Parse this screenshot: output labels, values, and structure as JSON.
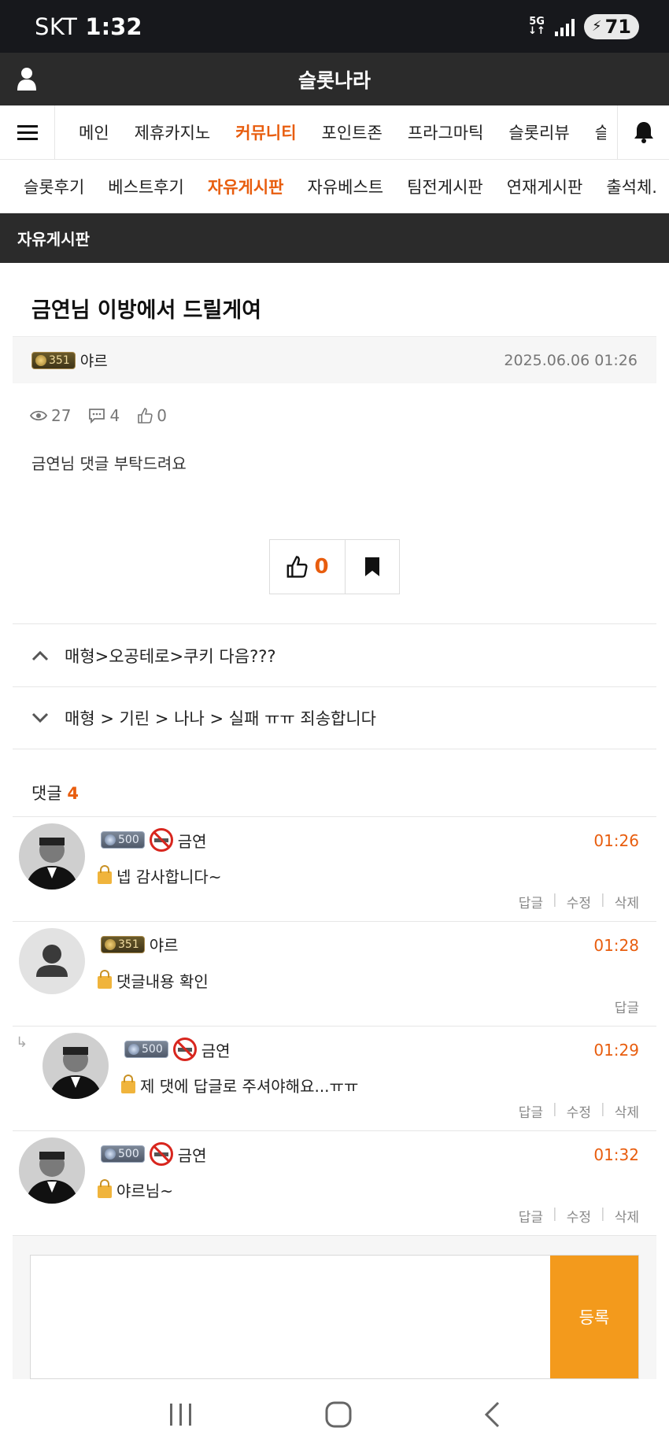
{
  "status": {
    "carrier": "SKT",
    "time": "1:32",
    "network": "5G",
    "battery": "71"
  },
  "app": {
    "title": "슬롯나라"
  },
  "main_nav": [
    {
      "label": "메인",
      "active": false
    },
    {
      "label": "제휴카지노",
      "active": false
    },
    {
      "label": "커뮤니티",
      "active": true
    },
    {
      "label": "포인트존",
      "active": false
    },
    {
      "label": "프라그마틱",
      "active": false
    },
    {
      "label": "슬롯리뷰",
      "active": false
    },
    {
      "label": "슬",
      "active": false
    }
  ],
  "sub_nav": [
    {
      "label": "슬롯후기",
      "active": false
    },
    {
      "label": "베스트후기",
      "active": false
    },
    {
      "label": "자유게시판",
      "active": true
    },
    {
      "label": "자유베스트",
      "active": false
    },
    {
      "label": "팀전게시판",
      "active": false
    },
    {
      "label": "연재게시판",
      "active": false
    },
    {
      "label": "출석체.",
      "active": false
    }
  ],
  "board": {
    "name": "자유게시판"
  },
  "post": {
    "title": "금연님 이방에서 드릴게여",
    "level": "351",
    "author": "야르",
    "date": "2025.06.06 01:26",
    "views": "27",
    "comments": "4",
    "likes": "0",
    "body": "금연님 댓글 부탁드려요",
    "vote_count": "0"
  },
  "prev_next": {
    "prev": "매형>오공테로>쿠키 다음???",
    "next": "매형 > 기린 > 나나 > 실패 ㅠㅠ 죄송합니다"
  },
  "comments_header": {
    "label": "댓글",
    "count": "4"
  },
  "comments": [
    {
      "level": "500",
      "author": "금연",
      "time": "01:26",
      "text": "넵 감사합니다~",
      "actions": [
        "답글",
        "수정",
        "삭제"
      ]
    },
    {
      "level": "351",
      "author": "야르",
      "time": "01:28",
      "text": "댓글내용 확인",
      "actions": [
        "답글"
      ]
    },
    {
      "level": "500",
      "author": "금연",
      "time": "01:29",
      "text": "제 댓에 답글로 주셔야해요...ㅠㅠ",
      "actions": [
        "답글",
        "수정",
        "삭제"
      ]
    },
    {
      "level": "500",
      "author": "금연",
      "time": "01:32",
      "text": "야르님~",
      "actions": [
        "답글",
        "수정",
        "삭제"
      ]
    }
  ],
  "editor": {
    "submit_label": "등록"
  },
  "colors": {
    "accent": "#e85d0e",
    "submit": "#f39a1c",
    "dark_bar": "#2b2b2b"
  }
}
